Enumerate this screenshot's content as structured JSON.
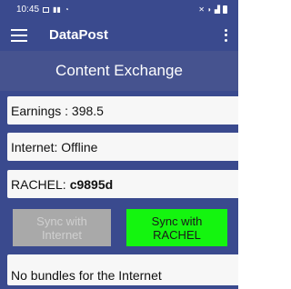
{
  "status_bar": {
    "time": "10:45",
    "bg_color": "#3a4a8e"
  },
  "app_bar": {
    "title": "DataPost",
    "menu_icon": "hamburger-menu-icon",
    "overflow_icon": "vertical-dots-icon"
  },
  "section": {
    "title": "Content Exchange"
  },
  "cards": {
    "earnings_label": "Earnings : 398.5",
    "internet_label": "Internet: Offline",
    "rachel_prefix": "RACHEL:",
    "rachel_id": "c9895d",
    "bundles_label": "No bundles for the Internet"
  },
  "buttons": {
    "sync_internet": "Sync with\nInternet",
    "sync_internet_state": "disabled",
    "sync_rachel": "Sync with\nRACHEL",
    "sync_rachel_color": "#14f50f"
  },
  "colors": {
    "primary": "#3a4a8e",
    "header": "#46538f",
    "card": "#f7f7f7"
  }
}
